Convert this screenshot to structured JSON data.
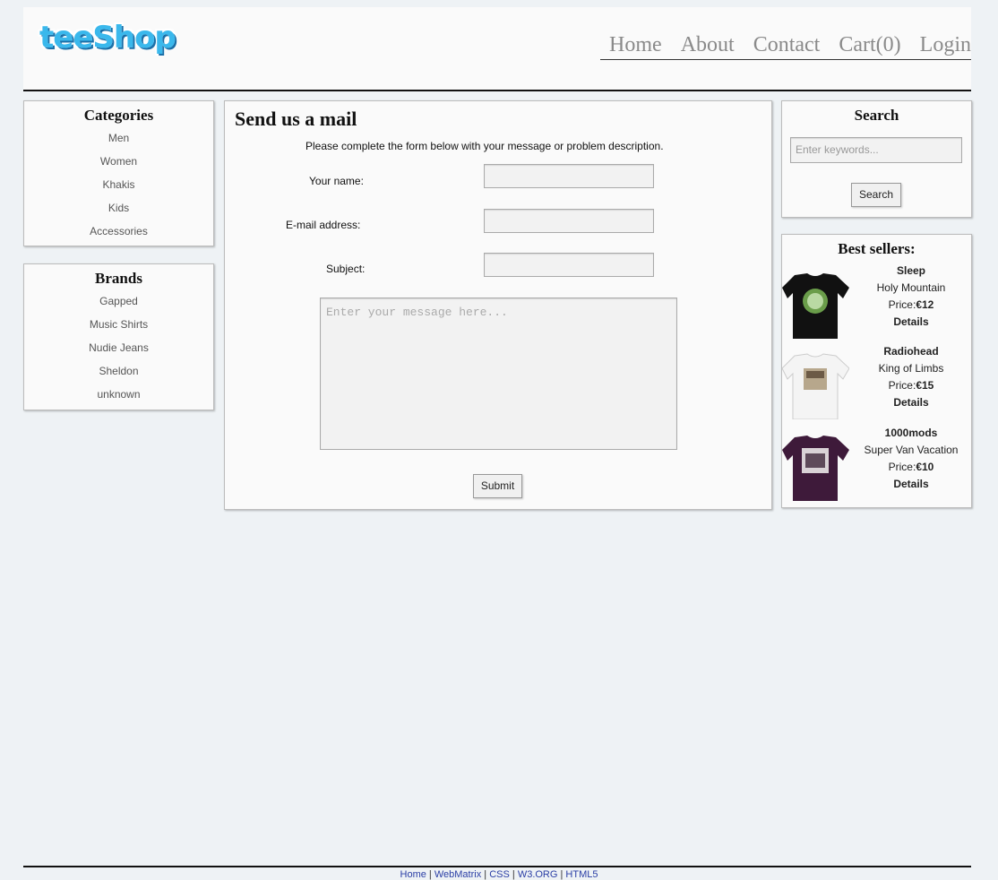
{
  "header": {
    "logo": "teeShop",
    "nav": [
      "Home",
      "About",
      "Contact",
      "Cart(0)",
      "Login"
    ]
  },
  "categories": {
    "title": "Categories",
    "items": [
      "Men",
      "Women",
      "Khakis",
      "Kids",
      "Accessories"
    ]
  },
  "brands": {
    "title": "Brands",
    "items": [
      "Gapped",
      "Music Shirts",
      "Nudie Jeans",
      "Sheldon",
      "unknown"
    ]
  },
  "form": {
    "title": "Send us a mail",
    "intro": "Please complete the form below with your message or problem description.",
    "name_label": "Your name:",
    "email_label": "E-mail address:",
    "subject_label": "Subject:",
    "message_placeholder": "Enter your message here...",
    "submit_label": "Submit"
  },
  "search": {
    "title": "Search",
    "placeholder": "Enter keywords...",
    "button_label": "Search"
  },
  "best_sellers": {
    "title": "Best sellers:",
    "items": [
      {
        "brand": "Sleep",
        "name": "Holy Mountain",
        "price_label": "Price:",
        "price": "€12",
        "details": "Details",
        "shirt_color": "#111111"
      },
      {
        "brand": "Radiohead",
        "name": "King of Limbs",
        "price_label": "Price:",
        "price": "€15",
        "details": "Details",
        "shirt_color": "#f4f4f4"
      },
      {
        "brand": "1000mods",
        "name": "Super Van Vacation",
        "price_label": "Price:",
        "price": "€10",
        "details": "Details",
        "shirt_color": "#3e1a3a"
      }
    ]
  },
  "footer": {
    "links": [
      "Home",
      "WebMatrix",
      "CSS",
      "W3.ORG",
      "HTML5"
    ]
  }
}
